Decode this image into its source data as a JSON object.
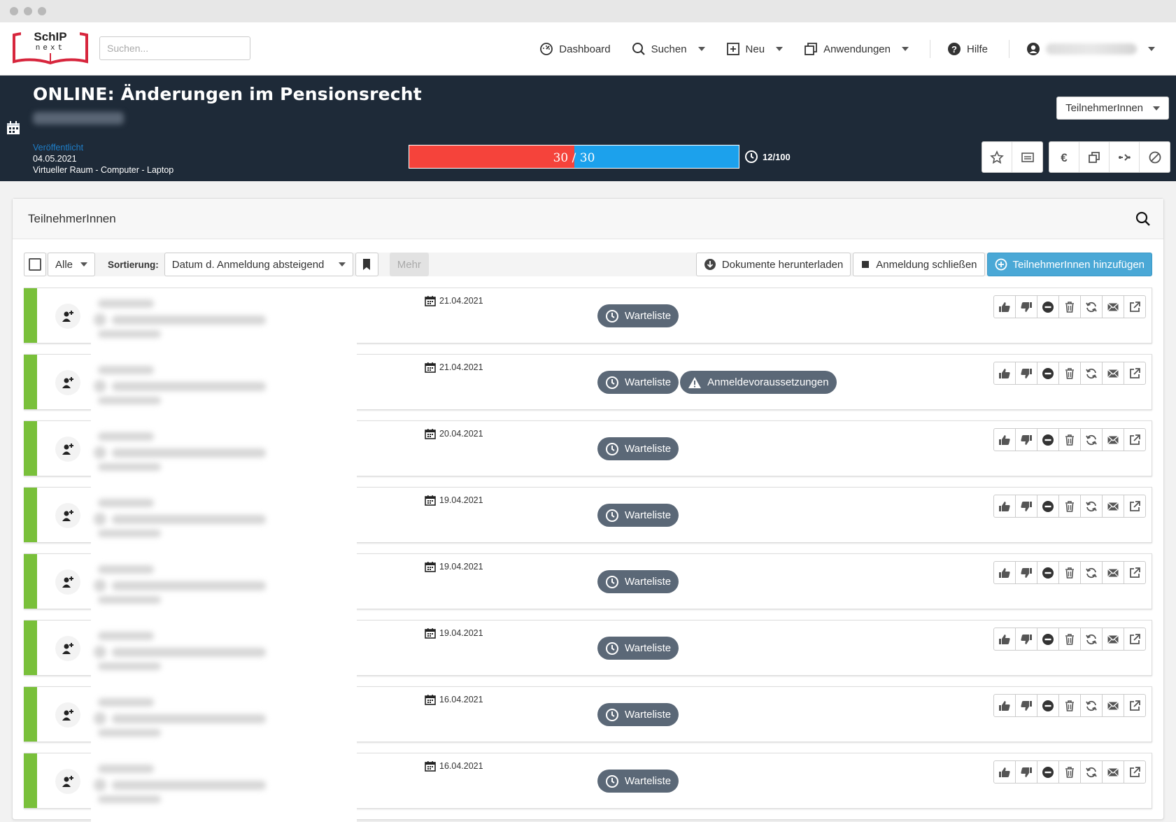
{
  "logo": {
    "text_top": "SchIP",
    "text_bottom": "next"
  },
  "search": {
    "placeholder": "Suchen..."
  },
  "nav": {
    "dashboard": "Dashboard",
    "suchen": "Suchen",
    "neu": "Neu",
    "anwendungen": "Anwendungen",
    "hilfe": "Hilfe"
  },
  "event": {
    "title": "ONLINE: Änderungen im Pensionsrecht",
    "published_label": "Veröffentlicht",
    "date": "04.05.2021",
    "location": "Virtueller Raum - Computer - Laptop",
    "progress": {
      "filled": 30,
      "total": 30,
      "fill_fraction": 0.5
    },
    "progress_left": "30",
    "progress_sep": "/",
    "progress_right": "30",
    "quota": "12/100",
    "view_select": "TeilnehmerInnen"
  },
  "panel": {
    "title": "TeilnehmerInnen",
    "filter_all": "Alle",
    "sort_label": "Sortierung:",
    "sort_value": "Datum d. Anmeldung absteigend",
    "more": "Mehr",
    "btn_download": "Dokumente herunterladen",
    "btn_close": "Anmeldung schließen",
    "btn_add": "TeilnehmerInnen hinzufügen"
  },
  "colors": {
    "header_bg": "#1e2a38",
    "status_green": "#79c03a",
    "progress_red": "#f5433b",
    "progress_blue": "#1ca1ec",
    "badge": "#5b6877",
    "primary": "#4aa8d6"
  },
  "rows": [
    {
      "date": "21.04.2021",
      "badges": [
        "Warteliste"
      ]
    },
    {
      "date": "21.04.2021",
      "badges": [
        "Warteliste",
        "Anmeldevoraussetzungen"
      ]
    },
    {
      "date": "20.04.2021",
      "badges": [
        "Warteliste"
      ]
    },
    {
      "date": "19.04.2021",
      "badges": [
        "Warteliste"
      ]
    },
    {
      "date": "19.04.2021",
      "badges": [
        "Warteliste"
      ]
    },
    {
      "date": "19.04.2021",
      "badges": [
        "Warteliste"
      ]
    },
    {
      "date": "16.04.2021",
      "badges": [
        "Warteliste"
      ]
    },
    {
      "date": "16.04.2021",
      "badges": [
        "Warteliste"
      ]
    }
  ]
}
